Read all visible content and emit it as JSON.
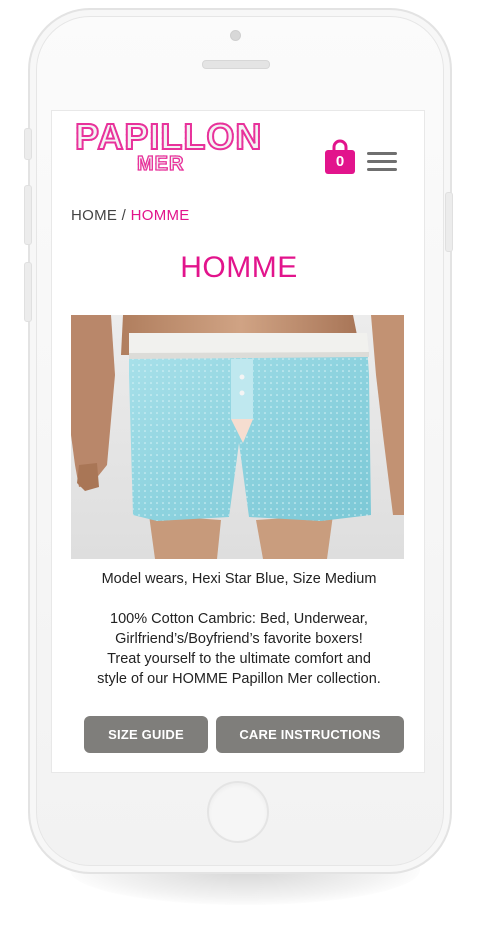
{
  "brand": {
    "name": "PAPILLON",
    "sub": "MER",
    "accent_color": "#e2148c"
  },
  "header": {
    "cart_icon": "shopping-bag-icon",
    "cart_count": "0",
    "menu_icon": "hamburger-menu-icon"
  },
  "breadcrumb": {
    "home": "HOME",
    "separator": " / ",
    "current": "HOMME"
  },
  "page": {
    "title": "HOMME"
  },
  "product": {
    "image_subject": "light-blue star-print boxer shorts on model",
    "caption": "Model wears, Hexi Star Blue, Size Medium",
    "description_lines": [
      "100% Cotton Cambric: Bed, Underwear,",
      "Girlfriend’s/Boyfriend’s favorite boxers!",
      "Treat yourself to the ultimate comfort and",
      "style of our HOMME Papillon Mer collection."
    ]
  },
  "buttons": {
    "size_guide": "SIZE GUIDE",
    "care_instructions": "CARE INSTRUCTIONS",
    "button_color": "#7f7e7b"
  }
}
